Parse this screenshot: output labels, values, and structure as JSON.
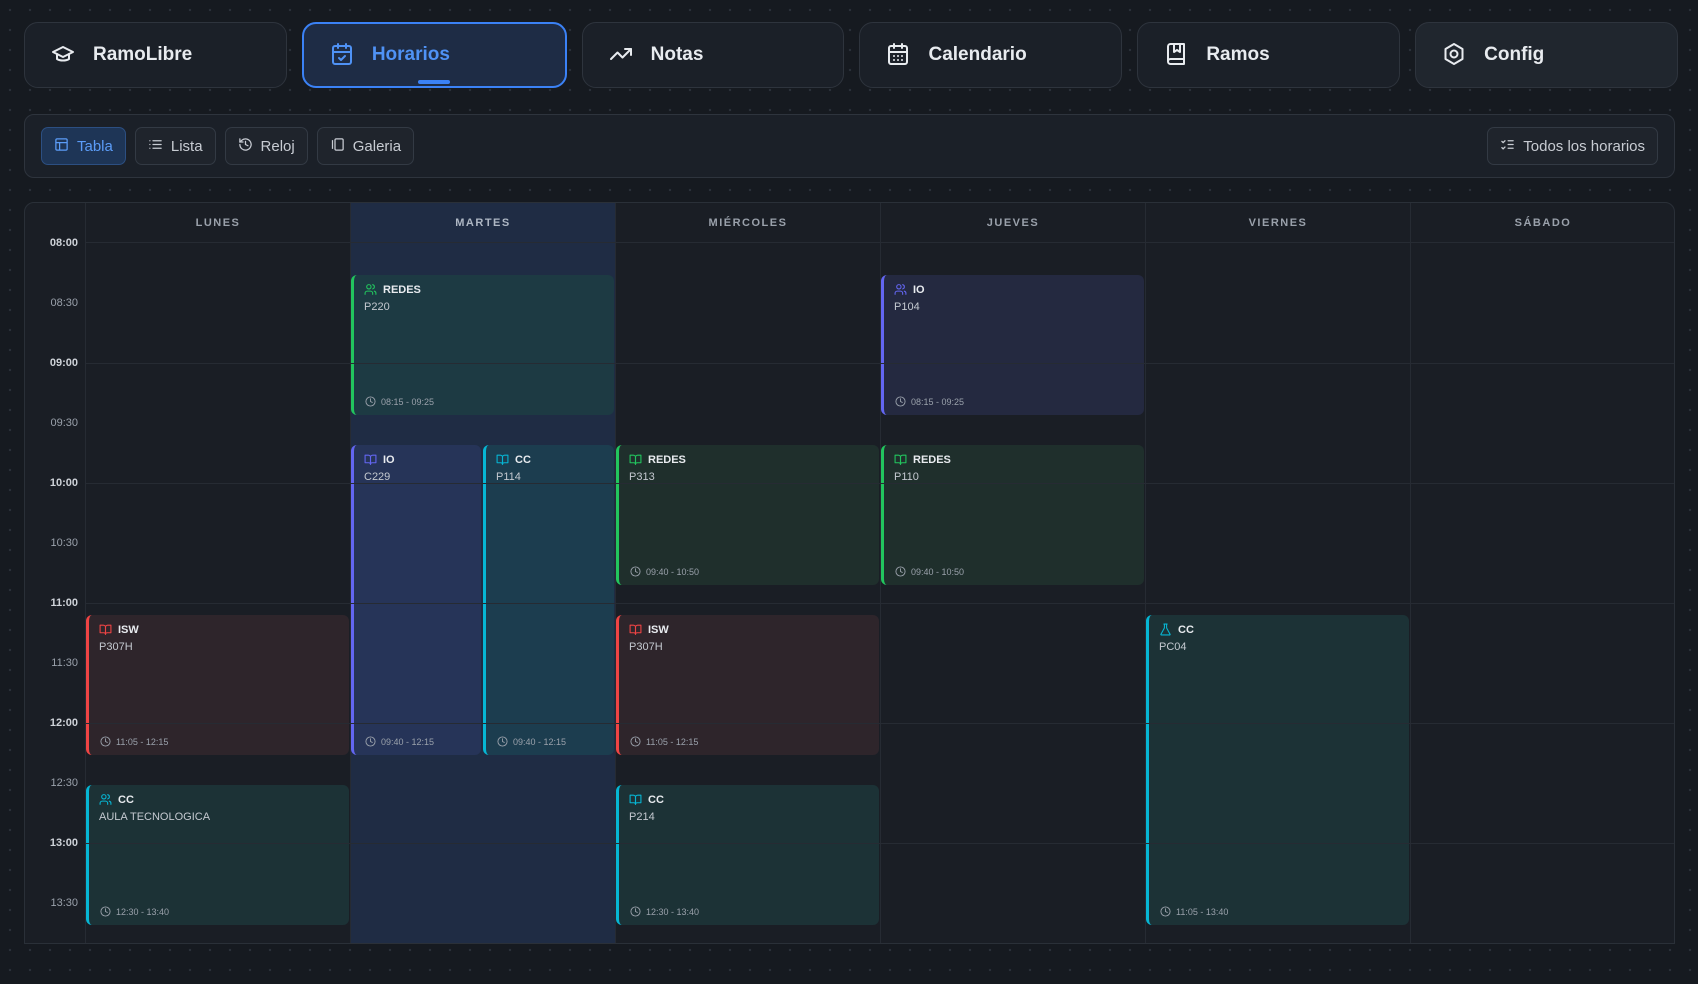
{
  "nav": {
    "tabs": [
      {
        "label": "RamoLibre",
        "icon": "graduation-cap-icon"
      },
      {
        "label": "Horarios",
        "icon": "calendar-check-icon",
        "active": true
      },
      {
        "label": "Notas",
        "icon": "trending-up-icon"
      },
      {
        "label": "Calendario",
        "icon": "calendar-icon"
      },
      {
        "label": "Ramos",
        "icon": "book-bookmark-icon"
      },
      {
        "label": "Config",
        "icon": "settings-icon"
      }
    ]
  },
  "toolbar": {
    "views": [
      {
        "label": "Tabla",
        "icon": "table-icon",
        "active": true
      },
      {
        "label": "Lista",
        "icon": "list-icon"
      },
      {
        "label": "Reloj",
        "icon": "history-icon"
      },
      {
        "label": "Galeria",
        "icon": "gallery-icon"
      }
    ],
    "filter_label": "Todos los horarios",
    "filter_icon": "list-checks-icon"
  },
  "schedule": {
    "days": [
      "LUNES",
      "MARTES",
      "MIÉRCOLES",
      "JUEVES",
      "VIERNES",
      "SÁBADO"
    ],
    "highlighted_day": "MARTES",
    "times": [
      "08:00",
      "08:30",
      "09:00",
      "09:30",
      "10:00",
      "10:30",
      "11:00",
      "11:30",
      "12:00",
      "12:30",
      "13:00",
      "13:30"
    ],
    "events": [
      {
        "course": "REDES",
        "room": "P220",
        "time": "08:15 - 09:25",
        "type": "users",
        "color": "#22c55e"
      },
      {
        "course": "IO",
        "room": "P104",
        "time": "08:15 - 09:25",
        "type": "users",
        "color": "#6366f1"
      },
      {
        "course": "IO",
        "room": "C229",
        "time": "09:40 - 12:15",
        "type": "book",
        "color": "#6366f1"
      },
      {
        "course": "CC",
        "room": "P114",
        "time": "09:40 - 12:15",
        "type": "book",
        "color": "#06b6d4"
      },
      {
        "course": "REDES",
        "room": "P313",
        "time": "09:40 - 10:50",
        "type": "book",
        "color": "#22c55e"
      },
      {
        "course": "REDES",
        "room": "P110",
        "time": "09:40 - 10:50",
        "type": "book",
        "color": "#22c55e"
      },
      {
        "course": "ISW",
        "room": "P307H",
        "time": "11:05 - 12:15",
        "type": "book",
        "color": "#ef4444"
      },
      {
        "course": "ISW",
        "room": "P307H",
        "time": "11:05 - 12:15",
        "type": "book",
        "color": "#ef4444"
      },
      {
        "course": "CC",
        "room": "PC04",
        "time": "11:05 - 13:40",
        "type": "flask",
        "color": "#06b6d4"
      },
      {
        "course": "CC",
        "room": "AULA TECNOLOGICA",
        "time": "12:30 - 13:40",
        "type": "users",
        "color": "#06b6d4"
      },
      {
        "course": "CC",
        "room": "P214",
        "time": "12:30 - 13:40",
        "type": "book",
        "color": "#06b6d4"
      }
    ]
  }
}
